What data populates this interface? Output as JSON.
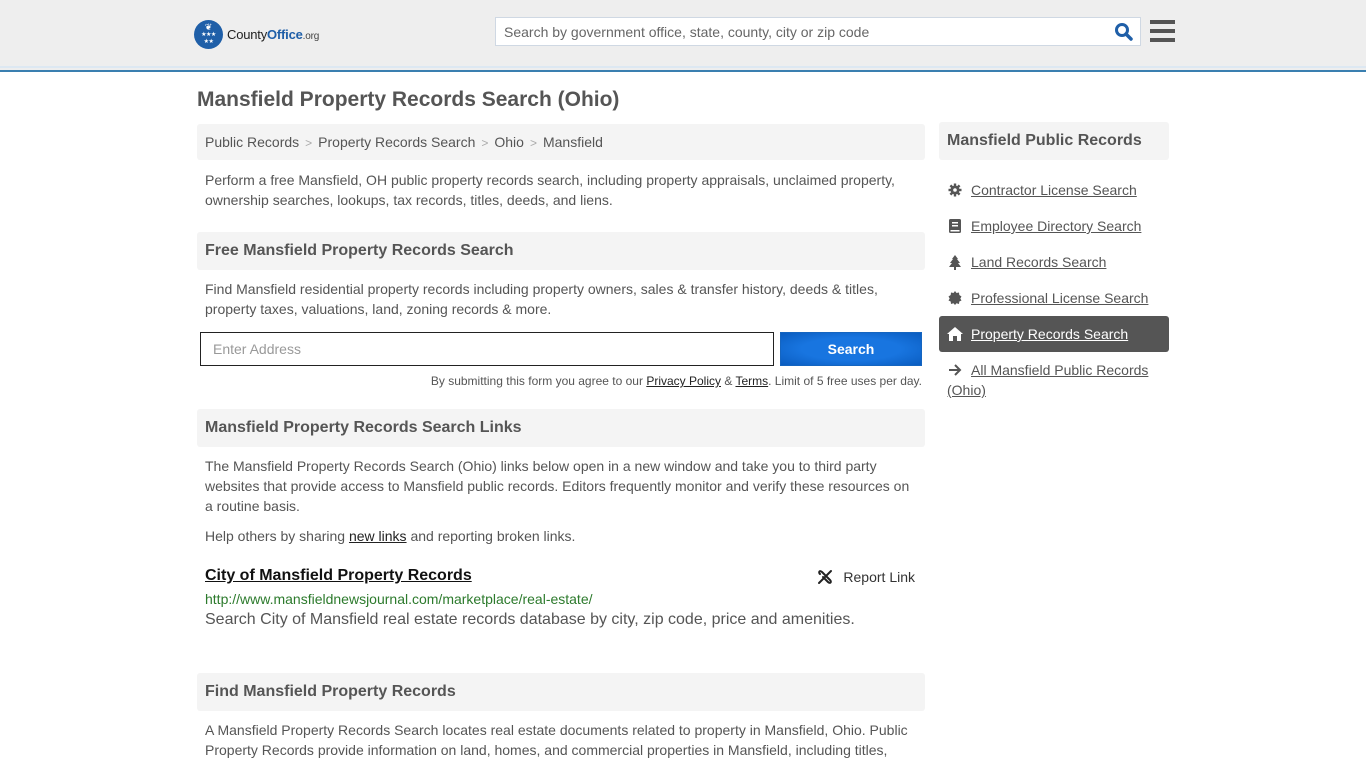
{
  "header": {
    "logo": {
      "brand_main": "County",
      "brand_accent": "Office",
      "brand_tld": ".org"
    },
    "search_placeholder": "Search by government office, state, county, city or zip code",
    "search_icon": "search-icon",
    "menu_icon": "hamburger-menu-icon"
  },
  "page": {
    "title": "Mansfield Property Records Search (Ohio)",
    "breadcrumb": [
      {
        "label": "Public Records"
      },
      {
        "label": "Property Records Search"
      },
      {
        "label": "Ohio"
      },
      {
        "label": "Mansfield"
      }
    ],
    "breadcrumb_separator": ">",
    "intro": "Perform a free Mansfield, OH public property records search, including property appraisals, unclaimed property, ownership searches, lookups, tax records, titles, deeds, and liens."
  },
  "free_search": {
    "heading": "Free Mansfield Property Records Search",
    "description": "Find Mansfield residential property records including property owners, sales & transfer history, deeds & titles, property taxes, valuations, land, zoning records & more.",
    "address_placeholder": "Enter Address",
    "button_label": "Search",
    "disclaimer_prefix": "By submitting this form you agree to our ",
    "privacy_label": "Privacy Policy",
    "amp": " & ",
    "terms_label": "Terms",
    "disclaimer_suffix": ". Limit of 5 free uses per day."
  },
  "links_section": {
    "heading": "Mansfield Property Records Search Links",
    "description": "The Mansfield Property Records Search (Ohio) links below open in a new window and take you to third party websites that provide access to Mansfield public records. Editors frequently monitor and verify these resources on a routine basis.",
    "help_prefix": "Help others by sharing ",
    "help_link": "new links",
    "help_suffix": " and reporting broken links.",
    "entries": [
      {
        "title": "City of Mansfield Property Records",
        "url": "http://www.mansfieldnewsjournal.com/marketplace/real-estate/",
        "description": "Search City of Mansfield real estate records database by city, zip code, price and amenities.",
        "report_label": "Report Link"
      }
    ]
  },
  "find_section": {
    "heading": "Find Mansfield Property Records",
    "description": "A Mansfield Property Records Search locates real estate documents related to property in Mansfield, Ohio. Public Property Records provide information on land, homes, and commercial properties in Mansfield, including titles,"
  },
  "sidebar": {
    "heading": "Mansfield Public Records",
    "items": [
      {
        "label": "Contractor License Search",
        "icon": "gear-icon",
        "active": false
      },
      {
        "label": "Employee Directory Search",
        "icon": "book-icon",
        "active": false
      },
      {
        "label": "Land Records Search",
        "icon": "tree-icon",
        "active": false
      },
      {
        "label": "Professional License Search",
        "icon": "certificate-icon",
        "active": false
      },
      {
        "label": "Property Records Search",
        "icon": "home-icon",
        "active": true
      },
      {
        "label": "All Mansfield Public Records (Ohio)",
        "icon": "arrow-right-icon",
        "active": false
      }
    ]
  },
  "colors": {
    "brand_blue": "#1f5fa8",
    "header_border": "#3a7fb0",
    "button_blue": "#1875e0",
    "url_green": "#2c7a2c",
    "active_bg": "#555555"
  }
}
